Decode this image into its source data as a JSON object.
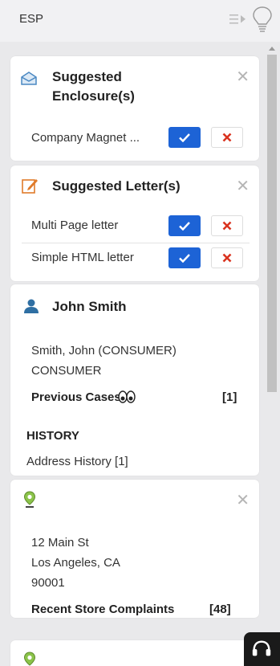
{
  "app": {
    "title": "ESP"
  },
  "cards": {
    "enclosures": {
      "title_line1": "Suggested",
      "title_line2": "Enclosure(s)",
      "items": [
        {
          "label": "Company Magnet ..."
        }
      ]
    },
    "letters": {
      "title": "Suggested Letter(s)",
      "items": [
        {
          "label": "Multi Page letter"
        },
        {
          "label": "Simple HTML letter"
        }
      ]
    },
    "contact": {
      "name": "John Smith",
      "full_name": "Smith, John (CONSUMER)",
      "type": "CONSUMER",
      "previous_cases_label": "Previous Cases",
      "previous_cases_count": "[1]",
      "history_heading": "HISTORY",
      "address_history": "Address History [1]"
    },
    "location": {
      "street": "12 Main St",
      "city": "Los Angeles, CA",
      "zip": "90001",
      "complaints_label": "Recent Store Complaints",
      "complaints_count": "[48]"
    }
  },
  "icons": {
    "envelope": "envelope-icon",
    "edit": "edit-icon",
    "person": "person-icon",
    "map_pin": "map-pin-icon",
    "eyes": "eyes-icon",
    "headset": "headset-icon"
  },
  "colors": {
    "accept": "#1d63d6",
    "reject": "#d9331f",
    "map_pin": "#8bc34a",
    "person": "#2f6fa3"
  }
}
